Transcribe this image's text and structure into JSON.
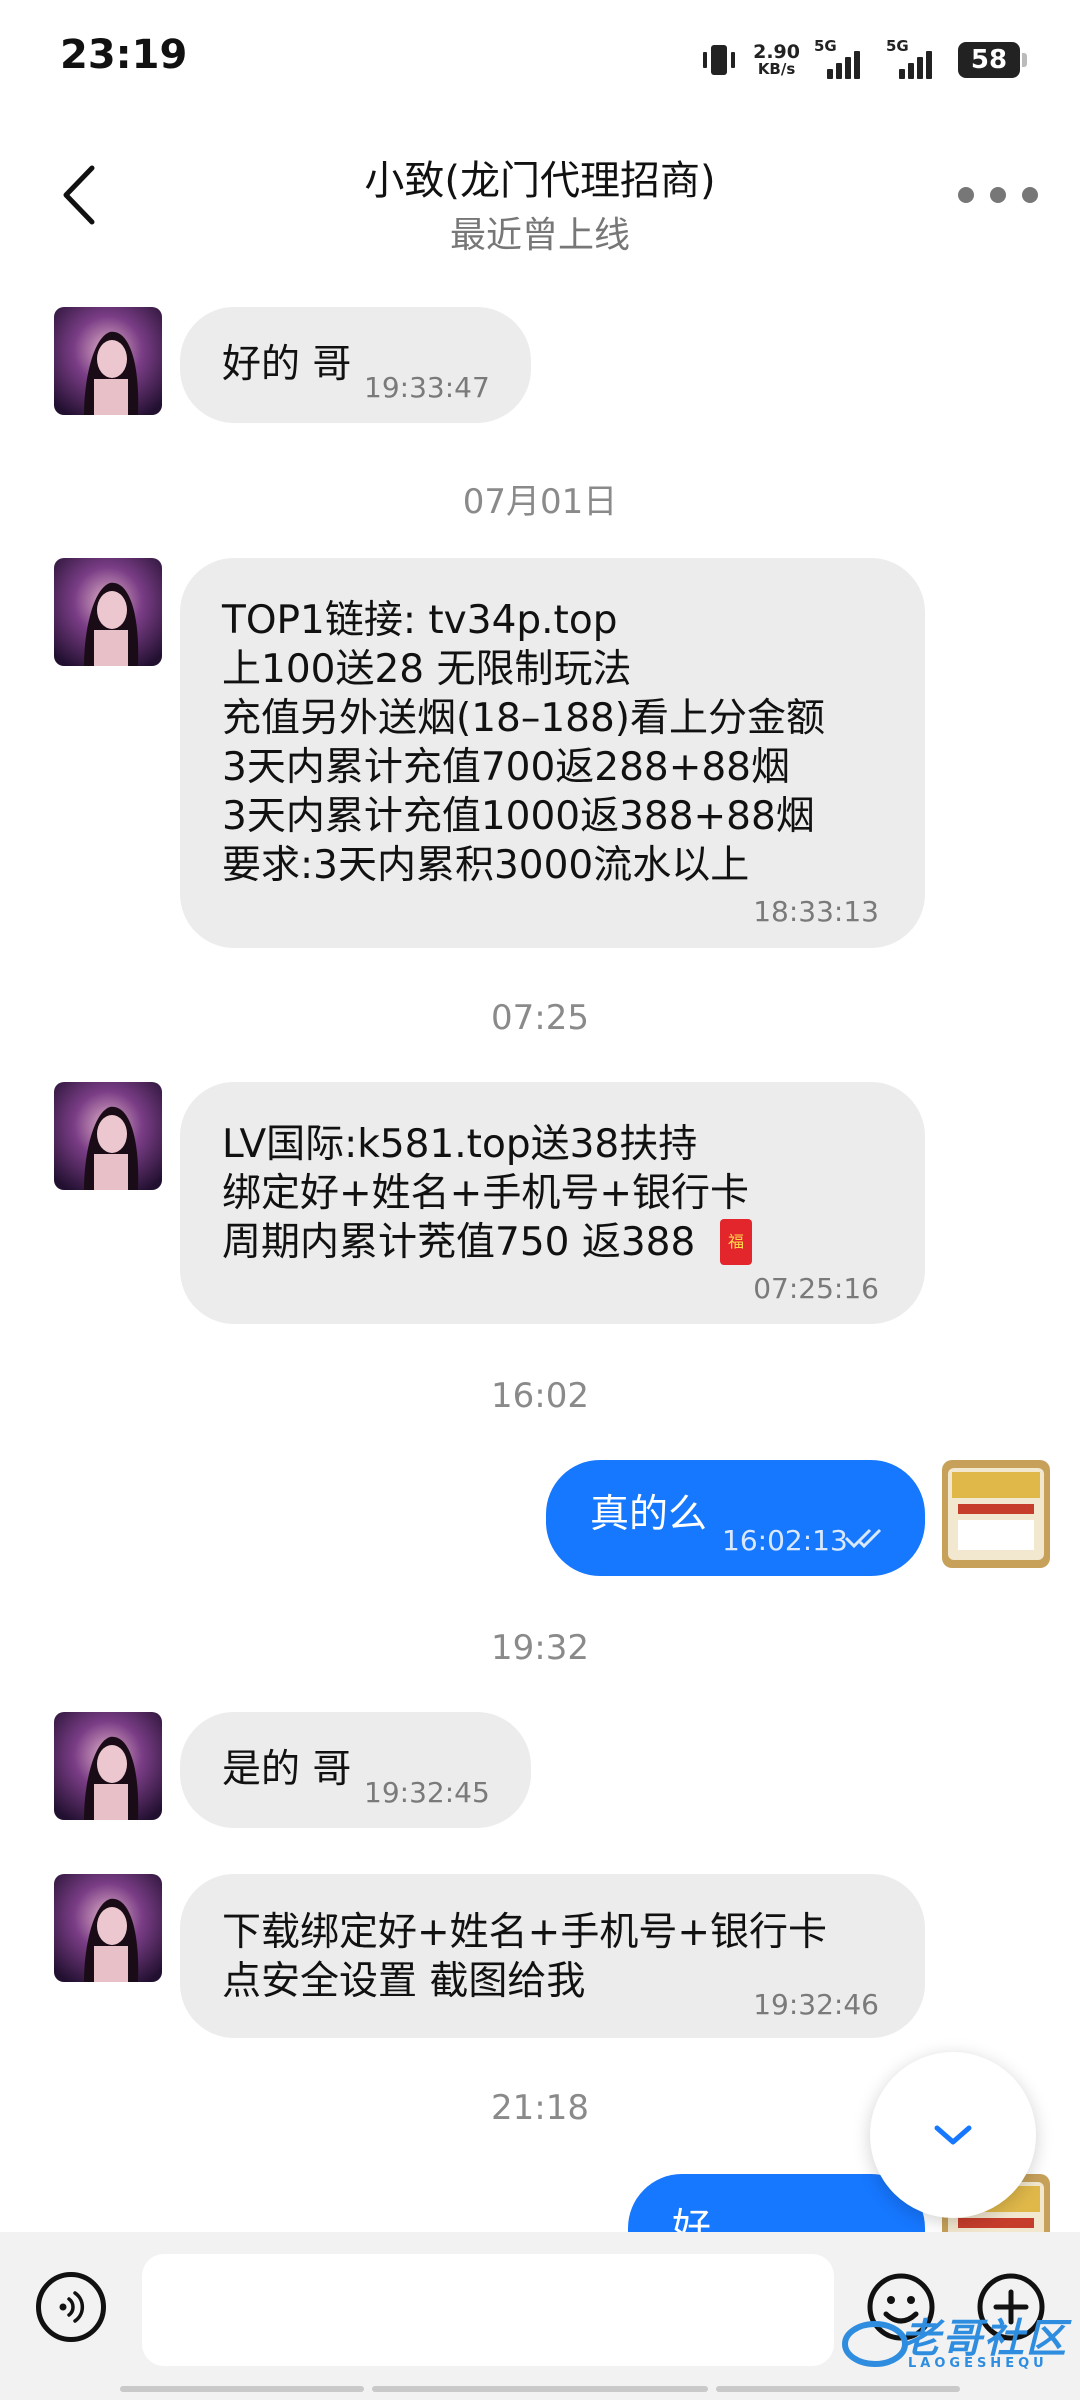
{
  "status_bar": {
    "time": "23:19",
    "net_speed_value": "2.90",
    "net_speed_unit": "KB/s",
    "sim1_label": "5G",
    "sim2_label": "5G",
    "battery": "58"
  },
  "header": {
    "title": "小致(龙门代理招商)",
    "subtitle": "最近曾上线"
  },
  "date_separators": [
    "07月01日",
    "07:25",
    "16:02",
    "19:32",
    "21:18"
  ],
  "messages": [
    {
      "direction": "in",
      "text": "好的 哥",
      "time": "19:33:47"
    },
    {
      "direction": "in",
      "text": "TOP1链接: tv34p.top\n上100送28 无限制玩法\n充值另外送烟(18–188)看上分金额\n3天内累计充值700返288+88烟\n3天内累计充值1000返388+88烟\n要求:3天内累积3000流水以上",
      "time": "18:33:13"
    },
    {
      "direction": "in",
      "text": "LV国际:k581.top送38扶持\n绑定好+姓名+手机号+银行卡\n周期内累计茺值750 返388",
      "time": "07:25:16",
      "emoji": "福"
    },
    {
      "direction": "out",
      "text": "真的么",
      "time": "16:02:13",
      "read": true
    },
    {
      "direction": "in",
      "text": "是的 哥",
      "time": "19:32:45"
    },
    {
      "direction": "in",
      "text": "下载绑定好+姓名+手机号+银行卡\n点安全设置 截图给我",
      "time": "19:32:46"
    },
    {
      "direction": "out",
      "text": "好",
      "time": ""
    }
  ],
  "input": {
    "placeholder": ""
  },
  "watermark": {
    "text": "老哥社区",
    "sub": "LAOGESHEQU"
  },
  "colors": {
    "outgoing_bubble": "#1677ff",
    "incoming_bubble": "#ececec",
    "accent": "#1677ff"
  },
  "icons": [
    "back-arrow-icon",
    "more-dots-icon",
    "chevron-down-icon",
    "voice-icon",
    "emoji-icon",
    "plus-icon",
    "double-check-icon",
    "red-envelope-icon"
  ]
}
